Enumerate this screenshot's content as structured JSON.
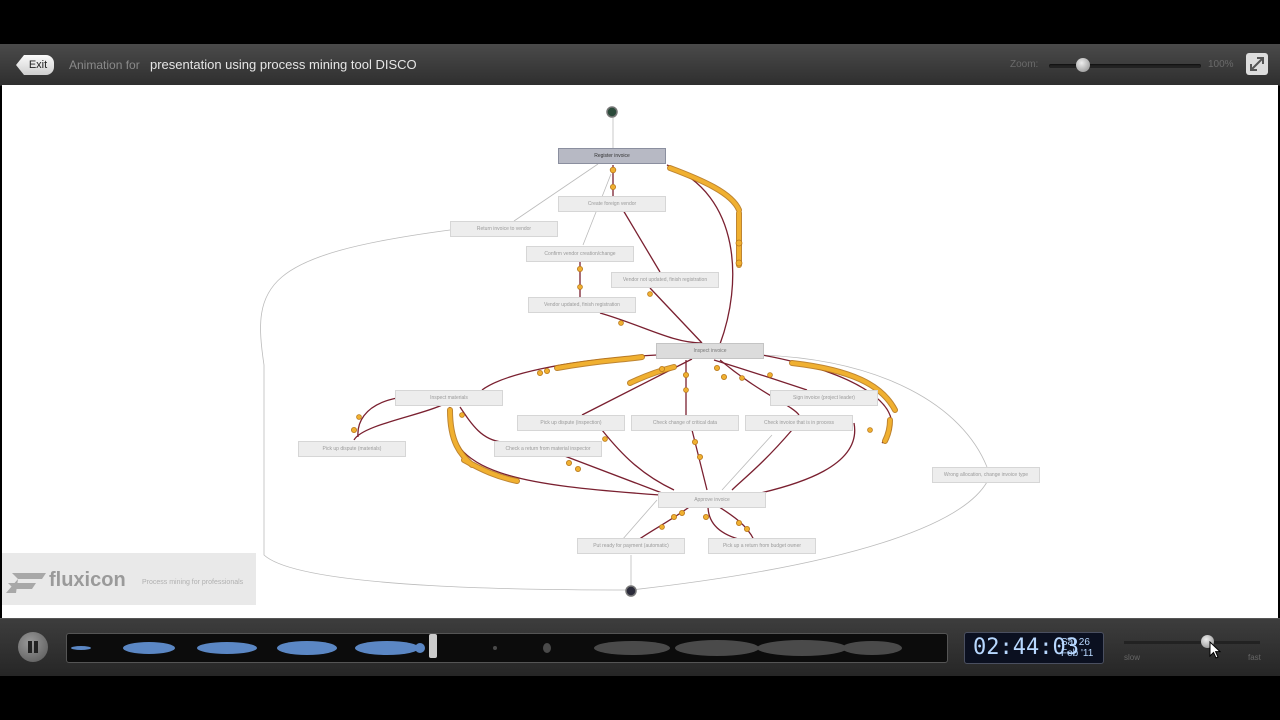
{
  "header": {
    "exit_label": "Exit",
    "animation_for_label": "Animation for",
    "title": "presentation using process mining tool DISCO",
    "zoom_label": "Zoom:",
    "zoom_value": "100%"
  },
  "nodes": [
    {
      "id": "register-invoice",
      "label": "Register invoice"
    },
    {
      "id": "create-foreign-vendor",
      "label": "Create foreign vendor"
    },
    {
      "id": "return-invoice",
      "label": "Return invoice to vendor"
    },
    {
      "id": "confirm-vendor",
      "label": "Confirm vendor creation/change"
    },
    {
      "id": "vendor-not-updated",
      "label": "Vendor not updated, finish registration"
    },
    {
      "id": "vendor-updated",
      "label": "Vendor updated, finish registration"
    },
    {
      "id": "inspect-invoice",
      "label": "Inspect invoice"
    },
    {
      "id": "inspect-materials",
      "label": "Inspect materials"
    },
    {
      "id": "sign-invoice",
      "label": "Sign invoice (project leader)"
    },
    {
      "id": "pickup-dispute-inspection",
      "label": "Pick up dispute (inspection)"
    },
    {
      "id": "check-critical-data",
      "label": "Check change of critical data"
    },
    {
      "id": "check-invoice-process",
      "label": "Check invoice that is in process"
    },
    {
      "id": "pickup-dispute-materials",
      "label": "Pick up dispute (materials)"
    },
    {
      "id": "check-return",
      "label": "Check a return from material inspector"
    },
    {
      "id": "wrong-allocation",
      "label": "Wrong allocation, change invoice type"
    },
    {
      "id": "approve-invoice",
      "label": "Approve invoice"
    },
    {
      "id": "put-ready-payment",
      "label": "Put ready for payment (automatic)"
    },
    {
      "id": "pickup-return-budget",
      "label": "Pick up a return from budget owner"
    }
  ],
  "brand": {
    "name": "fluxicon",
    "tagline": "Process mining for professionals"
  },
  "player": {
    "time": "02:44:03",
    "day": "Sat 26",
    "date": "Feb '11",
    "speed_slow": "slow",
    "speed_fast": "fast",
    "speed_level": 0.62,
    "timeline_progress": 0.41
  },
  "colors": {
    "edge": "#7a2030",
    "token": "#f0b030",
    "token_stroke": "#b8781c",
    "timeline_fill": "#5b87c4"
  }
}
